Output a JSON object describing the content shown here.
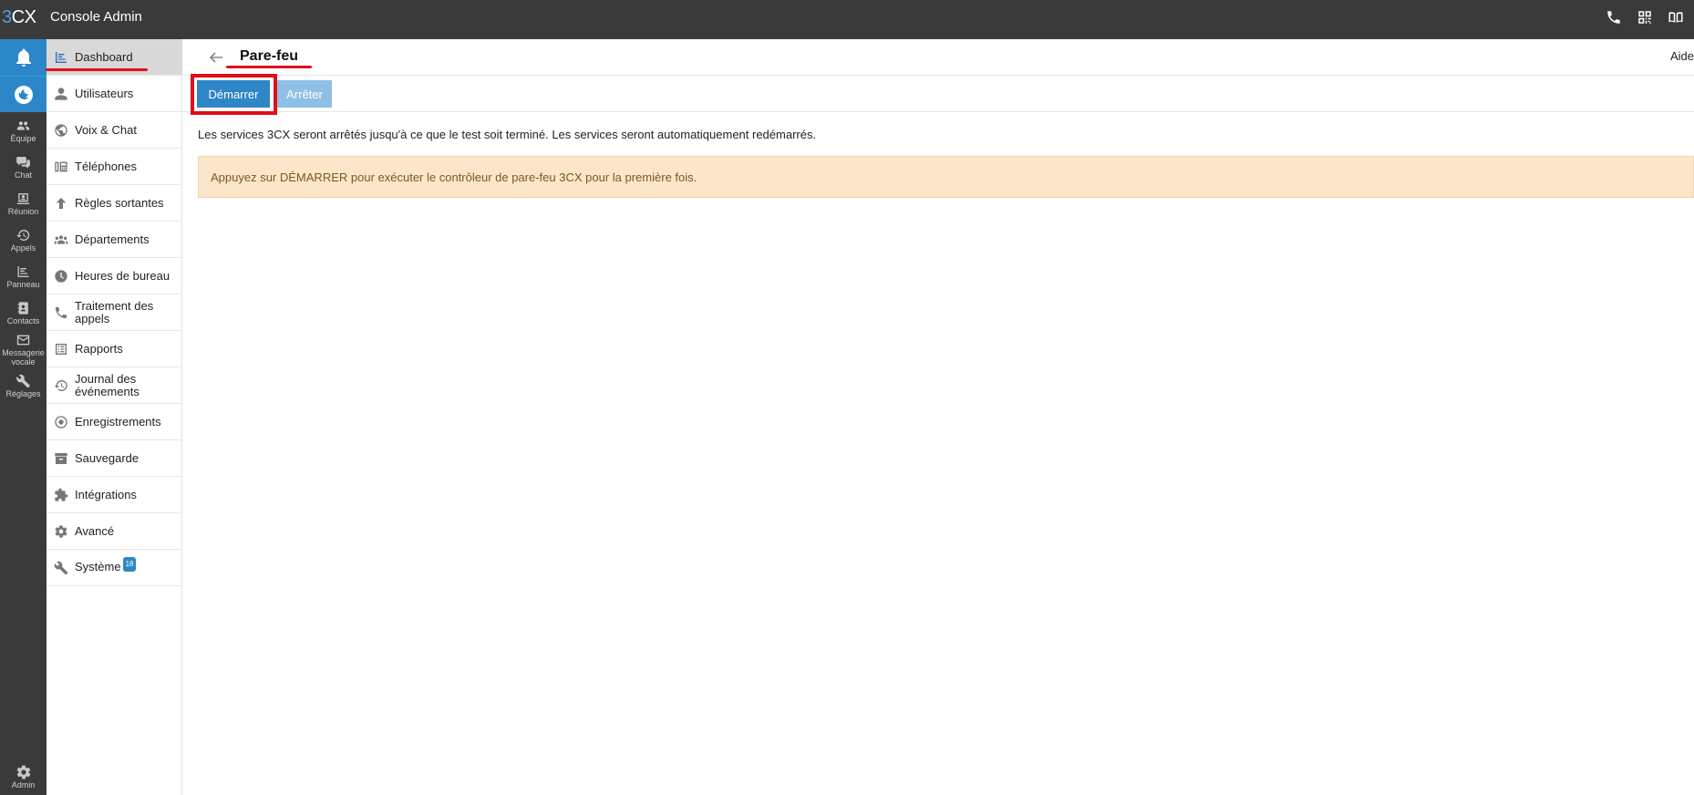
{
  "topbar": {
    "logo_digit": "3",
    "logo_text": "CX",
    "title": "Console Admin",
    "icons": [
      "phone-icon",
      "qr-code-icon",
      "book-icon"
    ]
  },
  "rail": {
    "items": [
      {
        "label": "Équipe",
        "icon": "team-icon"
      },
      {
        "label": "Chat",
        "icon": "chat-icon"
      },
      {
        "label": "Réunion",
        "icon": "meeting-icon"
      },
      {
        "label": "Appels",
        "icon": "history-icon"
      },
      {
        "label": "Panneau",
        "icon": "panel-icon"
      },
      {
        "label": "Contacts",
        "icon": "contacts-icon"
      },
      {
        "label": "Messagerie vocale",
        "icon": "voicemail-icon"
      },
      {
        "label": "Réglages",
        "icon": "wrench-icon"
      }
    ],
    "admin_label": "Admin"
  },
  "menu": {
    "items": [
      {
        "label": "Dashboard"
      },
      {
        "label": "Utilisateurs"
      },
      {
        "label": "Voix & Chat"
      },
      {
        "label": "Téléphones"
      },
      {
        "label": "Règles sortantes"
      },
      {
        "label": "Départements"
      },
      {
        "label": "Heures de bureau"
      },
      {
        "label": "Traitement des appels"
      },
      {
        "label": "Rapports"
      },
      {
        "label": "Journal des événements"
      },
      {
        "label": "Enregistrements"
      },
      {
        "label": "Sauvegarde"
      },
      {
        "label": "Intégrations"
      },
      {
        "label": "Avancé"
      },
      {
        "label": "Système",
        "badge": "18"
      }
    ]
  },
  "header": {
    "title": "Pare-feu",
    "help": "Aide"
  },
  "toolbar": {
    "start_label": "Démarrer",
    "stop_label": "Arrêter"
  },
  "content": {
    "info": "Les services 3CX seront arrêtés jusqu'à ce que le test soit terminé. Les services seront automatiquement redémarrés.",
    "alert": "Appuyez sur DÉMARRER pour exécuter le contrôleur de pare-feu 3CX pour la première fois."
  },
  "colors": {
    "accent": "#2f86c6",
    "highlight": "#e0101a",
    "alert_bg": "#fbe6c9"
  }
}
